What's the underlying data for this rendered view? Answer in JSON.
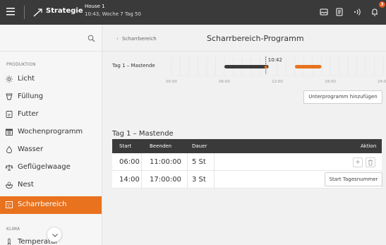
{
  "topbar": {
    "menu_icon": "hamburger-icon",
    "brand": "Strategie",
    "house": "House 1",
    "house_sub": "10:43, Woche 7 Tag 50",
    "notification_count": "3",
    "icons": [
      "message-icon",
      "document-icon",
      "broadcast-icon",
      "bell-icon"
    ]
  },
  "sidebar": {
    "search_icon": "search-icon",
    "section_production": "PRODUKTION",
    "section_climate": "KLIMA",
    "items": [
      {
        "label": "Licht",
        "icon": "light-icon"
      },
      {
        "label": "Füllung",
        "icon": "filling-icon"
      },
      {
        "label": "Futter",
        "icon": "feed-icon"
      },
      {
        "label": "Wochenprogramm",
        "icon": "calendar-icon"
      },
      {
        "label": "Wasser",
        "icon": "water-drop-icon"
      },
      {
        "label": "Geflügelwaage",
        "icon": "scale-icon"
      },
      {
        "label": "Nest",
        "icon": "nest-icon"
      },
      {
        "label": "Scharrbereich",
        "icon": "scratch-area-icon"
      },
      {
        "label": "Temperatur",
        "icon": "thermometer-icon"
      }
    ],
    "active_item": "Scharrbereich"
  },
  "main": {
    "breadcrumb": "Scharrbereich",
    "title": "Scharrbereich-Programm",
    "timeline": {
      "label": "Tag 1 – Mastende",
      "current_time": "10:42",
      "ticks": [
        "00:00",
        "06:00",
        "12:00",
        "18:00",
        "24:00"
      ],
      "bars": [
        {
          "start": "06:00",
          "end": "11:00",
          "color": "#3a3a3a"
        },
        {
          "start": "14:00",
          "end": "17:00",
          "color": "#e8721e"
        }
      ]
    },
    "add_subprogram_button": "Unterprogramm hinzufügen",
    "schedule": {
      "title": "Tag 1 – Mastende",
      "columns": [
        "Start",
        "Beenden",
        "Dauer",
        "Aktion"
      ],
      "rows": [
        {
          "start": "06:00",
          "end": "11:00:00",
          "duration": "5 St"
        },
        {
          "start": "14:00",
          "end": "17:00:00",
          "duration": "3 St"
        }
      ]
    },
    "start_day_number_button": "Start Tagesnummer"
  },
  "colors": {
    "accent": "#e8721e",
    "topbar": "#3a3a3a",
    "badge": "#e85a1b"
  }
}
